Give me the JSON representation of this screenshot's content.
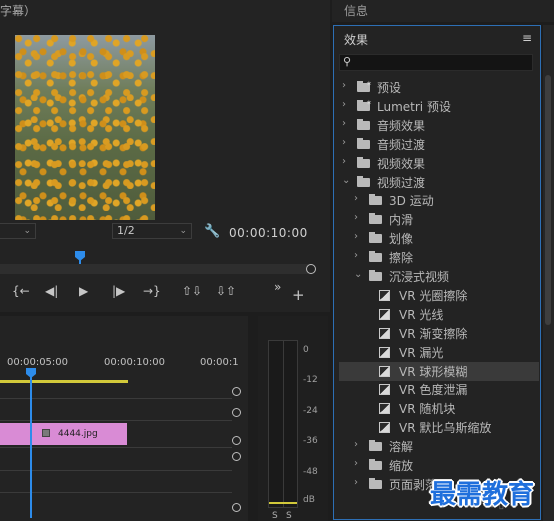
{
  "program_monitor": {
    "title_fragment": "字幕）",
    "fit_dropdown": "",
    "resolution_dropdown": "1/2",
    "timecode": "00:00:10:00",
    "transport": [
      "{←",
      "◀|",
      "▶",
      "|▶",
      "→}",
      "⇧⇩",
      "⇩⇧",
      "»",
      "+"
    ]
  },
  "timeline": {
    "time_labels": [
      "00:00:05:00",
      "00:00:10:00",
      "00:00:1"
    ],
    "clip_name": "4444.jpg"
  },
  "audio_meter": {
    "db_labels": [
      "0",
      "-12",
      "-24",
      "-36",
      "-48",
      "dB"
    ],
    "solo_labels": [
      "S",
      "S"
    ]
  },
  "info_panel": {
    "title": "信息"
  },
  "effects_panel": {
    "title": "效果",
    "menu_icon": "≡",
    "search_placeholder": "",
    "items": [
      {
        "label": "预设",
        "type": "folder-star",
        "indent": 0,
        "expanded": false
      },
      {
        "label": "Lumetri 预设",
        "type": "folder-star",
        "indent": 0,
        "expanded": false
      },
      {
        "label": "音频效果",
        "type": "folder",
        "indent": 0,
        "expanded": false
      },
      {
        "label": "音频过渡",
        "type": "folder",
        "indent": 0,
        "expanded": false
      },
      {
        "label": "视频效果",
        "type": "folder",
        "indent": 0,
        "expanded": false
      },
      {
        "label": "视频过渡",
        "type": "folder",
        "indent": 0,
        "expanded": true
      },
      {
        "label": "3D 运动",
        "type": "folder",
        "indent": 1,
        "expanded": false
      },
      {
        "label": "内滑",
        "type": "folder",
        "indent": 1,
        "expanded": false
      },
      {
        "label": "划像",
        "type": "folder",
        "indent": 1,
        "expanded": false
      },
      {
        "label": "擦除",
        "type": "folder",
        "indent": 1,
        "expanded": false
      },
      {
        "label": "沉浸式视频",
        "type": "folder",
        "indent": 1,
        "expanded": true
      },
      {
        "label": "VR 光圈擦除",
        "type": "vr",
        "indent": 2
      },
      {
        "label": "VR 光线",
        "type": "vr",
        "indent": 2
      },
      {
        "label": "VR 渐变擦除",
        "type": "vr",
        "indent": 2
      },
      {
        "label": "VR 漏光",
        "type": "vr",
        "indent": 2
      },
      {
        "label": "VR 球形模糊",
        "type": "vr",
        "indent": 2,
        "selected": true
      },
      {
        "label": "VR 色度泄漏",
        "type": "vr",
        "indent": 2
      },
      {
        "label": "VR 随机块",
        "type": "vr",
        "indent": 2
      },
      {
        "label": "VR 默比乌斯缩放",
        "type": "vr",
        "indent": 2
      },
      {
        "label": "溶解",
        "type": "folder",
        "indent": 1,
        "expanded": false
      },
      {
        "label": "缩放",
        "type": "folder",
        "indent": 1,
        "expanded": false
      },
      {
        "label": "页面剥落",
        "type": "folder",
        "indent": 1,
        "expanded": false
      }
    ]
  },
  "watermark": "最需教育"
}
